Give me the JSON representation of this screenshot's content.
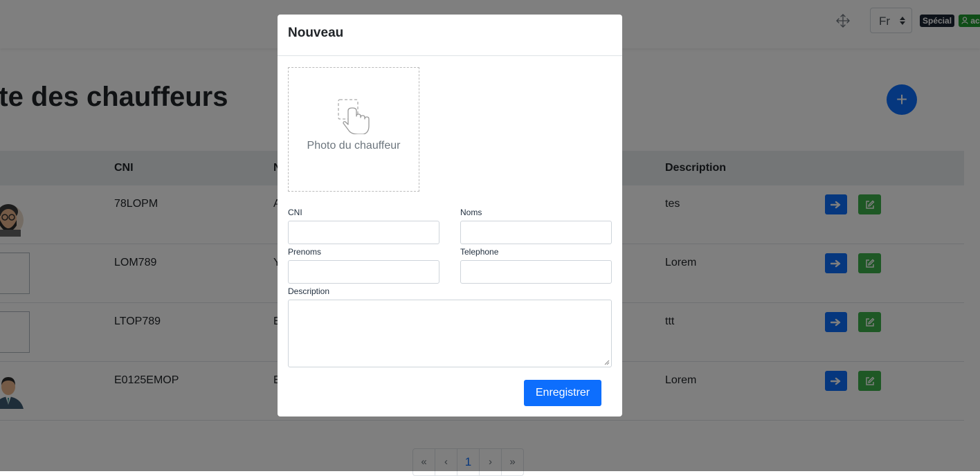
{
  "header": {
    "language": {
      "selected": "Fr"
    },
    "badges": {
      "special": "Spécial",
      "user": "ac"
    }
  },
  "page": {
    "title": "ste des chauffeurs",
    "add_button_label": "+"
  },
  "table": {
    "columns": [
      "CNI",
      "N",
      "Description"
    ],
    "rows": [
      {
        "cni": "78LOPM",
        "name_initial": "A",
        "description": "tes",
        "photo": "avatar-bearded"
      },
      {
        "cni": "LOM789",
        "name_initial": "Y",
        "description": "Lorem",
        "photo": "empty"
      },
      {
        "cni": "LTOP789",
        "name_initial": "E",
        "description": "ttt",
        "photo": "empty"
      },
      {
        "cni": "E0125EMOP",
        "name_initial": "E",
        "description": "Lorem",
        "photo": "avatar-suit"
      }
    ]
  },
  "pagination": {
    "first": "«",
    "prev": "‹",
    "current": "1",
    "next": "›",
    "last": "»"
  },
  "modal": {
    "title": "Nouveau",
    "photo_label": "Photo du chauffeur",
    "fields": {
      "cni": {
        "label": "CNI",
        "value": ""
      },
      "noms": {
        "label": "Noms",
        "value": ""
      },
      "prenoms": {
        "label": "Prenoms",
        "value": ""
      },
      "telephone": {
        "label": "Telephone",
        "value": ""
      },
      "description": {
        "label": "Description",
        "value": ""
      }
    },
    "submit_label": "Enregistrer"
  },
  "colors": {
    "primary": "#0d6efd",
    "success": "#3cb14a",
    "badge_dark": "#1b2433",
    "badge_green": "#1e9a2e",
    "backdrop": "rgba(0,0,0,0.5)"
  },
  "icons": [
    "move-icon",
    "caret-updown-icon",
    "user-icon",
    "plus-icon",
    "arrow-right-icon",
    "edit-icon",
    "tap-upload-icon",
    "resize-grip-icon"
  ]
}
